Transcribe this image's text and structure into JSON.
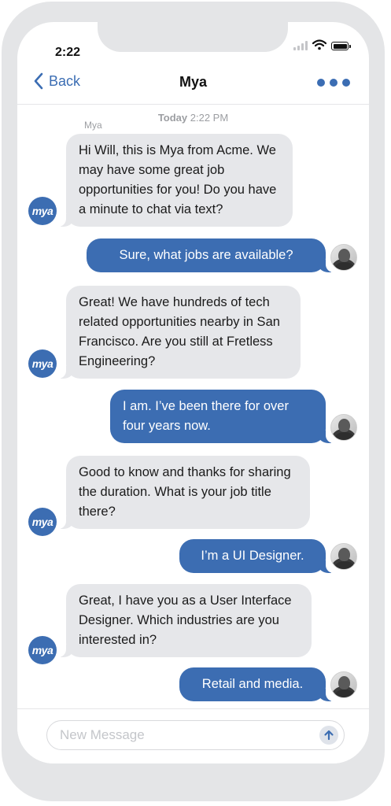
{
  "status_bar": {
    "time": "2:22"
  },
  "nav": {
    "back_label": "Back",
    "title": "Mya",
    "more_icon": "ellipsis-icon"
  },
  "thread": {
    "timestamp_day": "Today",
    "timestamp_time": "2:22 PM",
    "sender_name": "Mya",
    "bot_avatar_text": "mya",
    "messages": [
      {
        "from": "bot",
        "text": "Hi Will, this is Mya from Acme. We may have some great job opportunities for you! Do you have a minute to chat via text?"
      },
      {
        "from": "user",
        "text": "Sure, what jobs are available?"
      },
      {
        "from": "bot",
        "text": "Great! We have hundreds of tech related opportunities nearby in San Francisco. Are you still at Fretless Engineering?"
      },
      {
        "from": "user",
        "text": "I am. I’ve been there for over four years now."
      },
      {
        "from": "bot",
        "text": "Good to know and thanks for sharing the duration. What is your job title there?"
      },
      {
        "from": "user",
        "text": "I’m a UI Designer."
      },
      {
        "from": "bot",
        "text": "Great, I have you as a User Interface Designer. Which industries are you interested in?"
      },
      {
        "from": "user",
        "text": "Retail and media."
      }
    ]
  },
  "composer": {
    "placeholder": "New Message",
    "value": "",
    "send_icon": "arrow-up-icon"
  },
  "colors": {
    "accent": "#3c6db2",
    "incoming_bubble": "#e6e7ea",
    "frame": "#e4e5e7"
  }
}
